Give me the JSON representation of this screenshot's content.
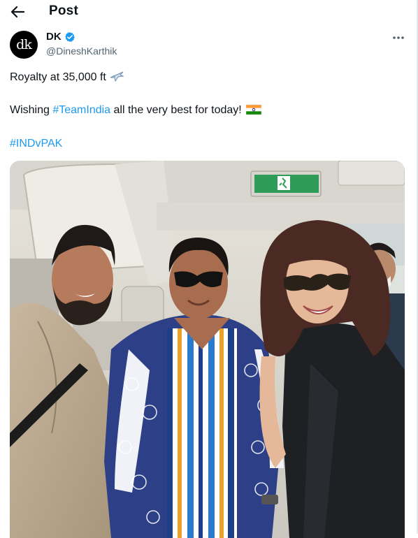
{
  "header": {
    "title": "Post",
    "back_icon": "arrow-left-icon"
  },
  "post": {
    "author": {
      "avatar_text": "dk",
      "display_name": "DK",
      "handle": "@DineshKarthik",
      "verified": true
    },
    "more_icon": "more-horizontal-icon",
    "line1": {
      "text": "Royalty at 35,000 ft",
      "emoji": "airplane-emoji"
    },
    "line2": {
      "prefix": "Wishing ",
      "hashtag": "#TeamIndia",
      "suffix": " all the very best for today!",
      "emoji": "india-flag-emoji"
    },
    "line3": {
      "hashtag": "#INDvPAK"
    },
    "media": {
      "kind": "photo"
    }
  },
  "colors": {
    "link": "#1d9bf0",
    "verified_badge": "#1d9bf0",
    "text": "#0f1419",
    "muted": "#536471"
  }
}
